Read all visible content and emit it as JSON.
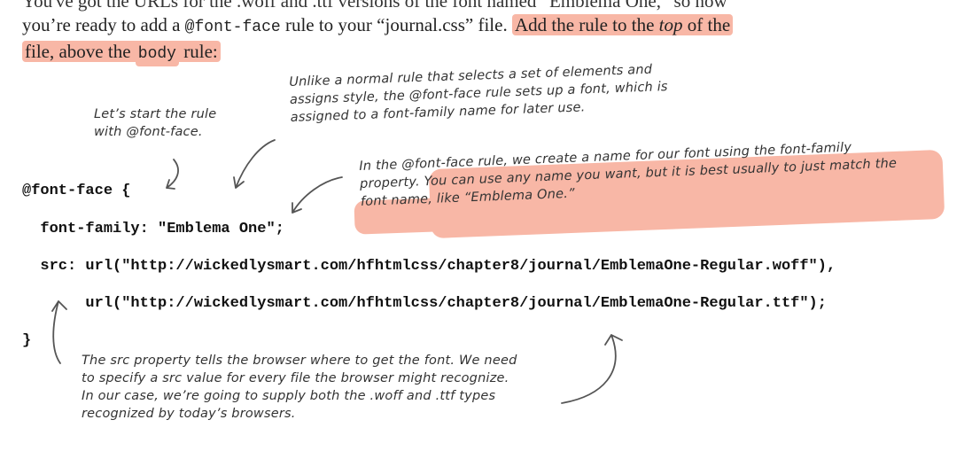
{
  "prose": {
    "line0": "You've got the URLs for the .woff and .ttf versions of the font named “Emblema One,” so now",
    "line1_a": "you’re ready to add a ",
    "line1_code": "@font-face",
    "line1_b": " rule to your “journal.css” file. ",
    "line1_hl": "Add the rule to the ",
    "line1_hl_em": "top",
    "line1_hl_end": " of the",
    "line2_a": "file, above the ",
    "line2_code": "body",
    "line2_b": " rule:"
  },
  "code": {
    "line1": "@font-face {",
    "line2": "  font-family: \"Emblema One\";",
    "line3": "  src: url(\"http://wickedlysmart.com/hfhtmlcss/chapter8/journal/EmblemaOne-Regular.woff\"),",
    "line4": "       url(\"http://wickedlysmart.com/hfhtmlcss/chapter8/journal/EmblemaOne-Regular.ttf\");",
    "line5": "}"
  },
  "notes": {
    "start": [
      "Let’s start the rule",
      "with @font-face."
    ],
    "unlike": [
      "Unlike a normal rule that selects a set of elements and",
      "assigns style, the @font-face rule sets up a font, which is",
      "assigned to a font-family name for later use."
    ],
    "name": [
      "In the @font-face rule, we create a name for our font using the font-family",
      "property. You can use any name you want, but it is best usually to just match the",
      "font name, like “Emblema One.”"
    ],
    "src": [
      "The src property tells the browser where to get the font. We need",
      "to specify a src value for every file the browser might recognize.",
      "In our case, we’re going to supply both the .woff and .ttf types",
      "recognized by today’s browsers."
    ]
  },
  "colors": {
    "highlight": "#f8b7a6",
    "text": "#222222",
    "annotation": "#333333"
  }
}
